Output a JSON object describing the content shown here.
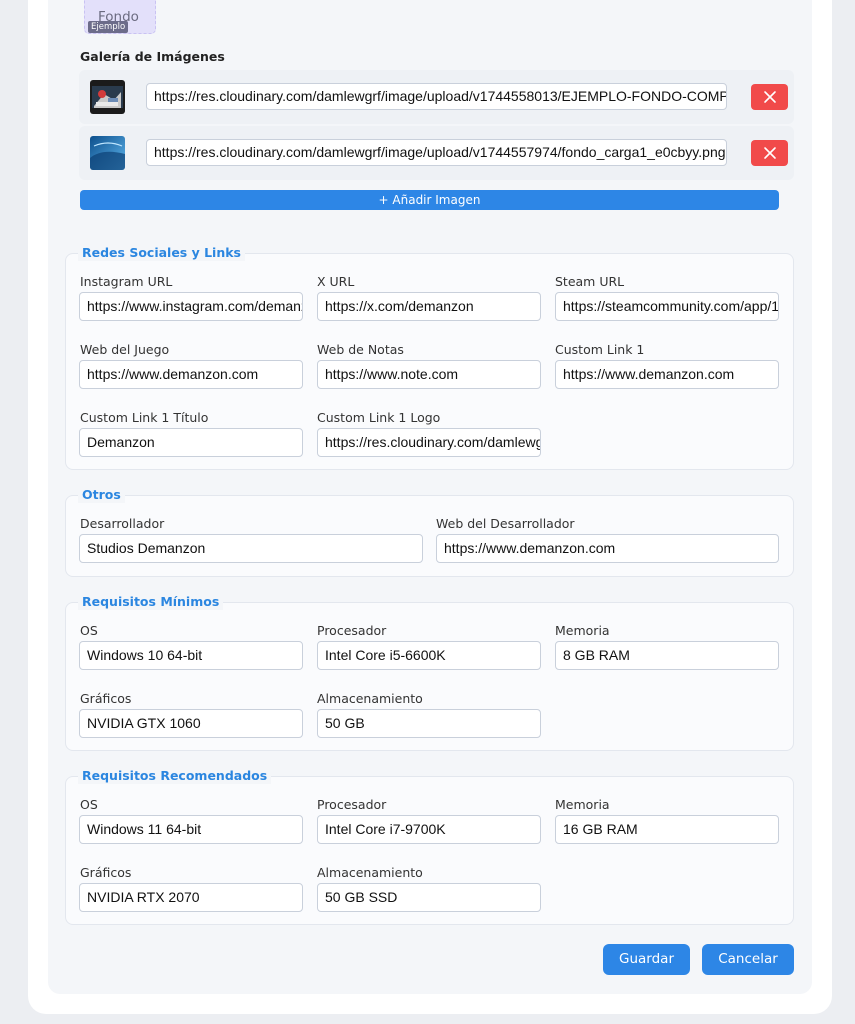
{
  "preview": {
    "fondo_label": "Fondo",
    "ejemplo_badge": "Ejemplo"
  },
  "gallery": {
    "title": "Galería de Imágenes",
    "items": [
      {
        "url": "https://res.cloudinary.com/damlewgrf/image/upload/v1744558013/EJEMPLO-FONDO-COMPLI"
      },
      {
        "url": "https://res.cloudinary.com/damlewgrf/image/upload/v1744557974/fondo_carga1_e0cbyy.png"
      }
    ],
    "add_label": "+ Añadir Imagen"
  },
  "social": {
    "legend": "Redes Sociales y Links",
    "instagram": {
      "label": "Instagram URL",
      "value": "https://www.instagram.com/demanz"
    },
    "x": {
      "label": "X URL",
      "value": "https://x.com/demanzon"
    },
    "steam": {
      "label": "Steam URL",
      "value": "https://steamcommunity.com/app/1"
    },
    "web_juego": {
      "label": "Web del Juego",
      "value": "https://www.demanzon.com"
    },
    "web_notas": {
      "label": "Web de Notas",
      "value": "https://www.note.com"
    },
    "custom1": {
      "label": "Custom Link 1",
      "value": "https://www.demanzon.com"
    },
    "custom1_title": {
      "label": "Custom Link 1 Título",
      "value": "Demanzon"
    },
    "custom1_logo": {
      "label": "Custom Link 1 Logo",
      "value": "https://res.cloudinary.com/damlewg"
    }
  },
  "otros": {
    "legend": "Otros",
    "desarrollador": {
      "label": "Desarrollador",
      "value": "Studios Demanzon"
    },
    "web_desarrollador": {
      "label": "Web del Desarrollador",
      "value": "https://www.demanzon.com"
    }
  },
  "min_req": {
    "legend": "Requisitos Mínimos",
    "os": {
      "label": "OS",
      "value": "Windows 10 64-bit"
    },
    "cpu": {
      "label": "Procesador",
      "value": "Intel Core i5-6600K"
    },
    "mem": {
      "label": "Memoria",
      "value": "8 GB RAM"
    },
    "gpu": {
      "label": "Gráficos",
      "value": "NVIDIA GTX 1060"
    },
    "storage": {
      "label": "Almacenamiento",
      "value": "50 GB"
    }
  },
  "rec_req": {
    "legend": "Requisitos Recomendados",
    "os": {
      "label": "OS",
      "value": "Windows 11 64-bit"
    },
    "cpu": {
      "label": "Procesador",
      "value": "Intel Core i7-9700K"
    },
    "mem": {
      "label": "Memoria",
      "value": "16 GB RAM"
    },
    "gpu": {
      "label": "Gráficos",
      "value": "NVIDIA RTX 2070"
    },
    "storage": {
      "label": "Almacenamiento",
      "value": "50 GB SSD"
    }
  },
  "actions": {
    "save": "Guardar",
    "cancel": "Cancelar"
  },
  "colors": {
    "accent": "#2d86e6",
    "danger": "#f14a4a",
    "legend": "#2b86e0"
  }
}
